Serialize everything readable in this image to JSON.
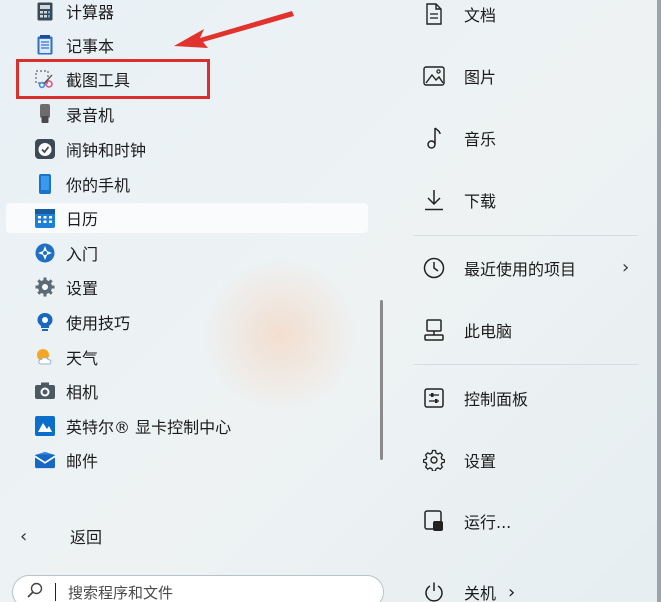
{
  "app_list": {
    "items": [
      {
        "label": "计算器",
        "icon": "calculator-icon"
      },
      {
        "label": "记事本",
        "icon": "notepad-icon"
      },
      {
        "label": "截图工具",
        "icon": "snipping-tool-icon"
      },
      {
        "label": "录音机",
        "icon": "voice-recorder-icon"
      },
      {
        "label": "闹钟和时钟",
        "icon": "clock-icon"
      },
      {
        "label": "你的手机",
        "icon": "phone-icon"
      },
      {
        "label": "日历",
        "icon": "calendar-icon"
      },
      {
        "label": "入门",
        "icon": "get-started-icon"
      },
      {
        "label": "设置",
        "icon": "settings-icon"
      },
      {
        "label": "使用技巧",
        "icon": "tips-icon"
      },
      {
        "label": "天气",
        "icon": "weather-icon"
      },
      {
        "label": "相机",
        "icon": "camera-icon"
      },
      {
        "label": "英特尔® 显卡控制中心",
        "icon": "intel-graphics-icon"
      },
      {
        "label": "邮件",
        "icon": "mail-icon"
      }
    ],
    "back_label": "返回"
  },
  "search": {
    "placeholder": "搜索程序和文件"
  },
  "right_pane": {
    "items": [
      {
        "label": "文档",
        "icon": "document-icon"
      },
      {
        "label": "图片",
        "icon": "pictures-icon"
      },
      {
        "label": "音乐",
        "icon": "music-icon"
      },
      {
        "label": "下载",
        "icon": "download-icon"
      },
      {
        "label": "最近使用的项目",
        "icon": "recent-icon"
      },
      {
        "label": "此电脑",
        "icon": "this-pc-icon"
      },
      {
        "label": "控制面板",
        "icon": "control-panel-icon"
      },
      {
        "label": "设置",
        "icon": "settings-icon"
      },
      {
        "label": "运行...",
        "icon": "run-icon"
      },
      {
        "label": "关机",
        "icon": "power-icon"
      }
    ]
  },
  "colors": {
    "highlight": "#d9302b",
    "accent": "#1a73c9"
  }
}
